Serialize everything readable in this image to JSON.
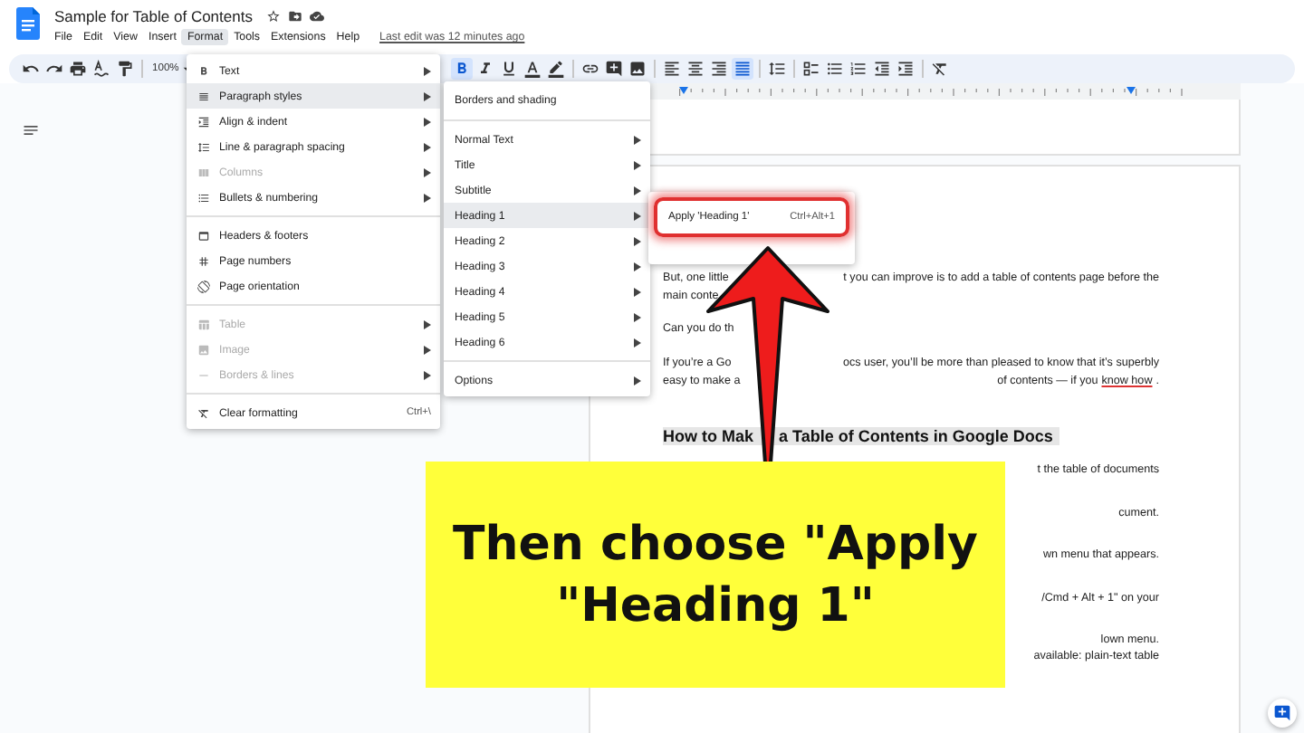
{
  "document": {
    "title": "Sample for Table of Contents",
    "last_edit": "Last edit was 12 minutes ago",
    "menu": [
      {
        "label": "File",
        "selected": false
      },
      {
        "label": "Edit",
        "selected": false
      },
      {
        "label": "View",
        "selected": false
      },
      {
        "label": "Insert",
        "selected": false
      },
      {
        "label": "Format",
        "selected": true
      },
      {
        "label": "Tools",
        "selected": false
      },
      {
        "label": "Extensions",
        "selected": false
      },
      {
        "label": "Help",
        "selected": false
      }
    ]
  },
  "toolbar": {
    "zoom": "100%",
    "buttons": [
      {
        "kind": "undo",
        "active": false
      },
      {
        "kind": "redo",
        "active": false
      },
      {
        "kind": "print",
        "active": false
      },
      {
        "kind": "spelling",
        "active": false
      },
      {
        "kind": "paint",
        "active": false
      },
      {
        "kind": "bold",
        "active": true
      },
      {
        "kind": "italic",
        "active": false
      },
      {
        "kind": "underline",
        "active": false
      },
      {
        "kind": "textcolor",
        "active": false
      },
      {
        "kind": "highlight",
        "active": false
      },
      {
        "kind": "link",
        "active": false
      },
      {
        "kind": "comment",
        "active": false
      },
      {
        "kind": "image",
        "active": false
      },
      {
        "kind": "alignleft",
        "active": false
      },
      {
        "kind": "aligncenter",
        "active": false
      },
      {
        "kind": "alignright",
        "active": false
      },
      {
        "kind": "justify",
        "active": true
      },
      {
        "kind": "linespacing",
        "active": false
      },
      {
        "kind": "tasklist",
        "active": false
      },
      {
        "kind": "bullets",
        "active": false
      },
      {
        "kind": "numbered",
        "active": false
      },
      {
        "kind": "outdent",
        "active": false
      },
      {
        "kind": "indent",
        "active": false
      },
      {
        "kind": "clear",
        "active": false
      }
    ]
  },
  "format_menu": {
    "groups": [
      [
        {
          "label": "Text",
          "submenu": true,
          "disabled": false,
          "selected": false
        },
        {
          "label": "Paragraph styles",
          "submenu": true,
          "disabled": false,
          "selected": true
        },
        {
          "label": "Align & indent",
          "submenu": true,
          "disabled": false,
          "selected": false
        },
        {
          "label": "Line & paragraph spacing",
          "submenu": true,
          "disabled": false,
          "selected": false
        },
        {
          "label": "Columns",
          "submenu": true,
          "disabled": true,
          "selected": false
        },
        {
          "label": "Bullets & numbering",
          "submenu": true,
          "disabled": false,
          "selected": false
        }
      ],
      [
        {
          "label": "Headers & footers",
          "submenu": false,
          "disabled": false,
          "selected": false
        },
        {
          "label": "Page numbers",
          "submenu": false,
          "disabled": false,
          "selected": false
        },
        {
          "label": "Page orientation",
          "submenu": false,
          "disabled": false,
          "selected": false
        }
      ],
      [
        {
          "label": "Table",
          "submenu": true,
          "disabled": true,
          "selected": false
        },
        {
          "label": "Image",
          "submenu": true,
          "disabled": true,
          "selected": false
        },
        {
          "label": "Borders & lines",
          "submenu": true,
          "disabled": true,
          "selected": false
        }
      ],
      [
        {
          "label": "Clear formatting",
          "submenu": false,
          "disabled": false,
          "selected": false,
          "shortcut": "Ctrl+\\"
        }
      ]
    ]
  },
  "paragraph_styles_menu": {
    "groups": [
      [
        {
          "label": "Borders and shading",
          "submenu": false,
          "selected": false
        }
      ],
      [
        {
          "label": "Normal Text",
          "submenu": true,
          "selected": false
        },
        {
          "label": "Title",
          "submenu": true,
          "selected": false
        },
        {
          "label": "Subtitle",
          "submenu": true,
          "selected": false
        },
        {
          "label": "Heading 1",
          "submenu": true,
          "selected": true
        },
        {
          "label": "Heading 2",
          "submenu": true,
          "selected": false
        },
        {
          "label": "Heading 3",
          "submenu": true,
          "selected": false
        },
        {
          "label": "Heading 4",
          "submenu": true,
          "selected": false
        },
        {
          "label": "Heading 5",
          "submenu": true,
          "selected": false
        },
        {
          "label": "Heading 6",
          "submenu": true,
          "selected": false
        }
      ],
      [
        {
          "label": "Options",
          "submenu": true,
          "selected": false
        }
      ]
    ]
  },
  "heading_menu": {
    "items": [
      {
        "label": "Apply 'Heading 1'",
        "shortcut": "Ctrl+Alt+1",
        "highlighted": true
      }
    ]
  },
  "page": {
    "lines": [
      {
        "left": "But, one little",
        "right": [
          {
            "text": "t you can improve is to add a table of contents page before the",
            "link": false
          }
        ]
      },
      {
        "left": "main conte"
      },
      {
        "left": "Can you do th"
      },
      {
        "left": "If you’re a Go",
        "right": [
          {
            "text": "ocs user, you’ll be more than pleased to know that it’s superbly",
            "link": false
          }
        ]
      },
      {
        "left": "easy to make a",
        "right": [
          {
            "text": "of contents — if you",
            "link": false
          },
          {
            "text": "know how",
            "link": true
          },
          {
            "text": ".",
            "link": false
          }
        ]
      }
    ],
    "heading": {
      "left": "How to Mak",
      "right": "a Table of Contents in Google Docs"
    },
    "side_paragraphs": [
      [
        "t the table of documents"
      ],
      [
        "cument."
      ],
      [
        "wn menu that appears."
      ],
      [
        "/Cmd + Alt + 1\" on your"
      ],
      [
        "lown menu.",
        "available: plain-text table"
      ]
    ]
  },
  "callout": {
    "text": "Then choose \"Apply \"Heading 1\""
  }
}
